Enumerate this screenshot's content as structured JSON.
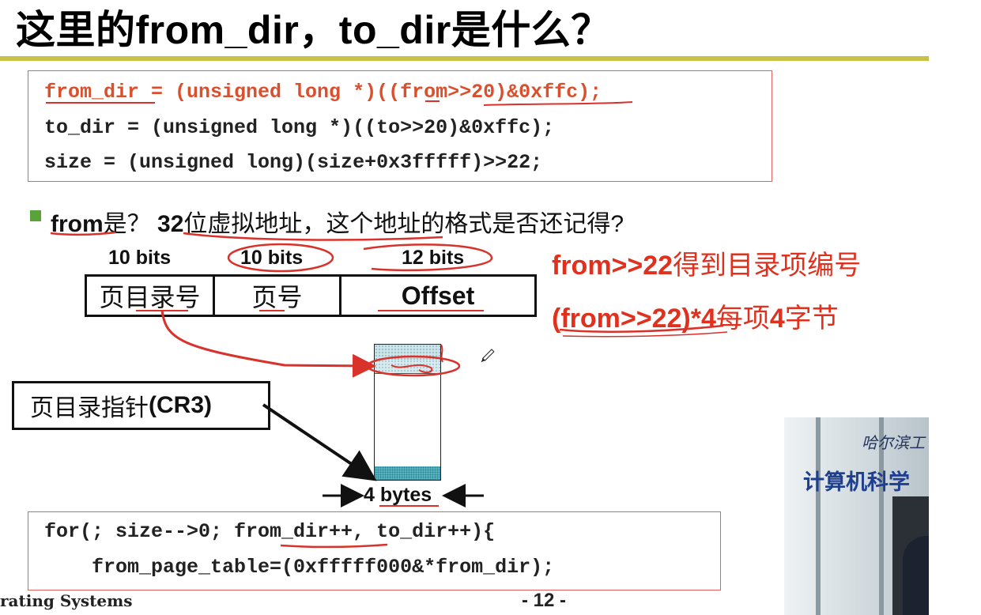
{
  "slide": {
    "title": "这里的from_dir，to_dir是什么？",
    "code_top": [
      "from_dir = (unsigned long *)((from>>20)&0xffc);",
      "to_dir = (unsigned long *)((to>>20)&0xffc);",
      "size = (unsigned long)(size+0x3fffff)>>22;"
    ],
    "question": {
      "lead": "from",
      "middle": "是？",
      "num": "32",
      "rest": "位虚拟地址，这个地址的格式是否还记得?"
    },
    "bits_labels": [
      "10 bits",
      "10 bits",
      "12 bits"
    ],
    "address_fields": [
      "页目录号",
      "页号",
      "Offset"
    ],
    "notes": {
      "line1_bold": "from>>22",
      "line1_rest": "得到目录项编号",
      "line2_bold_a": "(from>>22)*4",
      "line2_rest_a": "每项",
      "line2_bold_b": "4",
      "line2_rest_b": "字节"
    },
    "cr3": {
      "zh": "页目录指针",
      "en": "(CR3)"
    },
    "bytes_label": "4 bytes",
    "code_bottom": [
      "for(; size-->0; from_dir++, to_dir++){",
      "    from_page_table=(0xfffff000&*from_dir);"
    ],
    "footer": "rating Systems",
    "page_number": "- 12 -"
  },
  "video": {
    "school": "哈尔滨工",
    "dept": "计算机科学"
  },
  "colors": {
    "accent_rule": "#c8c24a",
    "code_border": "#e06060",
    "annotation_red": "#e0301e",
    "code_red": "#d9502e"
  }
}
